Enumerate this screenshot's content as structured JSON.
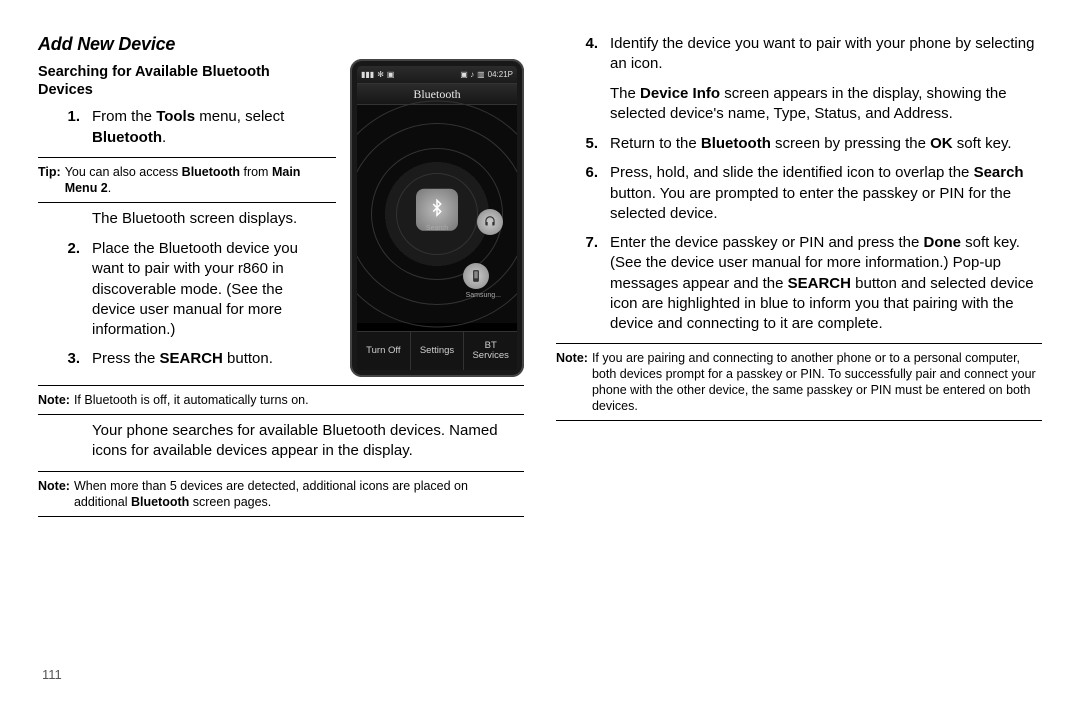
{
  "left": {
    "section_title": "Add New Device",
    "subhead": "Searching for Available Bluetooth Devices",
    "step1_a": "From the ",
    "step1_b": "Tools",
    "step1_c": " menu, select ",
    "step1_d": "Bluetooth",
    "step1_e": ".",
    "tip_label": "Tip:",
    "tip_a": " You can also access ",
    "tip_b": "Bluetooth",
    "tip_c": " from ",
    "tip_d": "Main Menu 2",
    "tip_e": ".",
    "after_step1": "The Bluetooth screen displays.",
    "step2": "Place the Bluetooth device you want to pair with your r860 in discoverable mode. (See the device user manual for more information.)",
    "step3_a": "Press the ",
    "step3_b": "SEARCH",
    "step3_c": " button.",
    "note1_label": "Note:",
    "note1_body": " If Bluetooth is off, it automatically turns on.",
    "after_step3": "Your phone searches for available Bluetooth devices. Named icons for available devices appear in the display.",
    "note2_label": "Note:",
    "note2_a": " When more than 5 devices are detected, additional icons are placed on additional ",
    "note2_b": "Bluetooth",
    "note2_c": " screen pages.",
    "page_num": "111"
  },
  "right": {
    "step4": "Identify the device you want to pair with your phone by selecting an icon.",
    "after4_a": "The ",
    "after4_b": "Device Info",
    "after4_c": " screen appears in the display, showing the selected device's name, Type, Status, and Address.",
    "step5_a": "Return to the ",
    "step5_b": "Bluetooth",
    "step5_c": " screen by pressing the ",
    "step5_d": "OK",
    "step5_e": " soft key.",
    "step6_a": "Press, hold, and slide the identified icon to overlap the ",
    "step6_b": "Search",
    "step6_c": " button. You are prompted to enter the passkey or PIN for the selected device.",
    "step7_a": "Enter the device passkey or PIN and press the ",
    "step7_b": "Done",
    "step7_c": " soft key. (See the device user manual for more information.) Pop-up messages appear and the ",
    "step7_d": "SEARCH",
    "step7_e": " button and selected device icon are highlighted in blue to inform you that pairing with the device and connecting to it are complete.",
    "note_label": "Note:",
    "note_body": " If you are pairing and connecting to another phone or to a personal computer, both devices prompt for a passkey or PIN. To successfully pair and connect your phone with the other device, the same passkey or PIN must be entered on both devices."
  },
  "phone": {
    "time": "04:21P",
    "title": "Bluetooth",
    "center_label": "Search",
    "dev2_label": "Samsung...",
    "soft1": "Turn Off",
    "soft2": "Settings",
    "soft3": "BT Services"
  }
}
